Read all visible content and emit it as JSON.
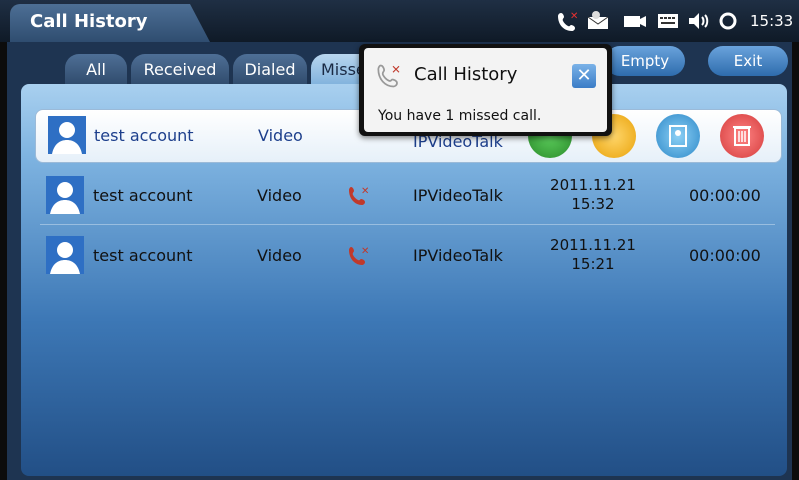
{
  "app": {
    "title": "Call History"
  },
  "status_bar": {
    "icons": [
      "missed-call-icon",
      "message-icon",
      "camera-icon",
      "keyboard-icon",
      "volume-icon",
      "sync-icon"
    ],
    "time": "15:33"
  },
  "tabs": [
    {
      "label": "All",
      "active": false
    },
    {
      "label": "Received",
      "active": false
    },
    {
      "label": "Dialed",
      "active": false
    },
    {
      "label": "Missed",
      "active": true
    }
  ],
  "toolbar": {
    "empty_label": "Empty",
    "exit_label": "Exit"
  },
  "calls": [
    {
      "name": "test account",
      "type": "Video",
      "account": "IPVideoTalk",
      "date": "",
      "time": "",
      "duration": "",
      "selected": true
    },
    {
      "name": "test account",
      "type": "Video",
      "account": "IPVideoTalk",
      "date": "2011.11.21",
      "time": "15:32",
      "duration": "00:00:00",
      "selected": false
    },
    {
      "name": "test account",
      "type": "Video",
      "account": "IPVideoTalk",
      "date": "2011.11.21",
      "time": "15:21",
      "duration": "00:00:00",
      "selected": false
    }
  ],
  "row_actions": [
    "call-icon",
    "message-icon",
    "contact-icon",
    "delete-icon"
  ],
  "popup": {
    "title": "Call History",
    "message": "You have 1 missed call.",
    "close_label": "✕"
  },
  "colors": {
    "accent": "#3a7cc6",
    "missed": "#c0392b",
    "delete": "#e04b4b",
    "call": "#3aa63a",
    "message": "#f2b11d"
  }
}
